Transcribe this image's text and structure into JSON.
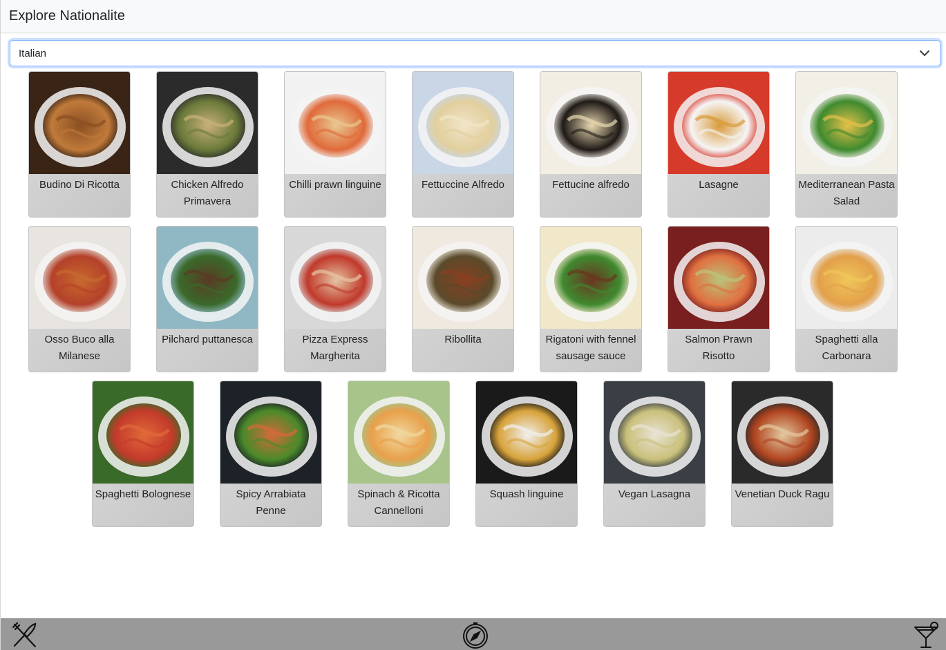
{
  "header": {
    "title": "Explore Nationalite"
  },
  "filter": {
    "selected": "Italian"
  },
  "meals": [
    {
      "name": "Budino Di Ricotta",
      "colors": [
        "#3a2416",
        "#8a4f22",
        "#c07a3a"
      ]
    },
    {
      "name": "Chicken Alfredo Primavera",
      "colors": [
        "#2b2b2b",
        "#c9b07a",
        "#6a7a3a"
      ]
    },
    {
      "name": "Chilli prawn linguine",
      "colors": [
        "#f2f2f2",
        "#e8c790",
        "#e06a3a"
      ]
    },
    {
      "name": "Fettuccine Alfredo",
      "colors": [
        "#c9d6e6",
        "#f1e5c8",
        "#e2cf9e"
      ]
    },
    {
      "name": "Fettucine alfredo",
      "colors": [
        "#f3eee4",
        "#e8d8b0",
        "#1f1a17"
      ]
    },
    {
      "name": "Lasagne",
      "colors": [
        "#d63a2a",
        "#d99a3a",
        "#f5f5f5"
      ]
    },
    {
      "name": "Mediterranean Pasta Salad",
      "colors": [
        "#f2efe6",
        "#e4c14a",
        "#3f8a2f"
      ]
    },
    {
      "name": "Osso Buco alla Milanese",
      "colors": [
        "#e8e4df",
        "#c8692e",
        "#b4412a"
      ]
    },
    {
      "name": "Pilchard puttanesca",
      "colors": [
        "#8fb8c4",
        "#5a3a24",
        "#3a6a2a"
      ]
    },
    {
      "name": "Pizza Express Margherita",
      "colors": [
        "#d8d8d8",
        "#e5c4a3",
        "#c0392b"
      ]
    },
    {
      "name": "Ribollita",
      "colors": [
        "#efe9df",
        "#8a3f22",
        "#5a4a2a"
      ]
    },
    {
      "name": "Rigatoni with fennel sausage sauce",
      "colors": [
        "#f1e7c9",
        "#6a3420",
        "#3f8a2f"
      ]
    },
    {
      "name": "Salmon Prawn Risotto",
      "colors": [
        "#7a1f1f",
        "#b9c47a",
        "#e07040"
      ]
    },
    {
      "name": "Spaghetti alla Carbonara",
      "colors": [
        "#ececec",
        "#f0c65a",
        "#e2a04a"
      ]
    },
    {
      "name": "Spaghetti Bolognese",
      "colors": [
        "#3a6a2a",
        "#e06a3a",
        "#c33a2a"
      ]
    },
    {
      "name": "Spicy Arrabiata Penne",
      "colors": [
        "#1d2228",
        "#d56a3a",
        "#4a8a2a"
      ]
    },
    {
      "name": "Spinach & Ricotta Cannelloni",
      "colors": [
        "#a8c48a",
        "#f0d8a0",
        "#e8a04a"
      ]
    },
    {
      "name": "Squash linguine",
      "colors": [
        "#1a1a1a",
        "#f0f0f0",
        "#d8a33a"
      ]
    },
    {
      "name": "Vegan Lasagna",
      "colors": [
        "#3a3f45",
        "#e8e3d5",
        "#c9c07a"
      ]
    },
    {
      "name": "Venetian Duck Ragu",
      "colors": [
        "#2a2a2a",
        "#e3c9a0",
        "#b0441f"
      ]
    }
  ],
  "footer": {
    "icons": [
      "utensils-icon",
      "compass-icon",
      "cocktail-icon"
    ],
    "bar_color": "#999999"
  }
}
